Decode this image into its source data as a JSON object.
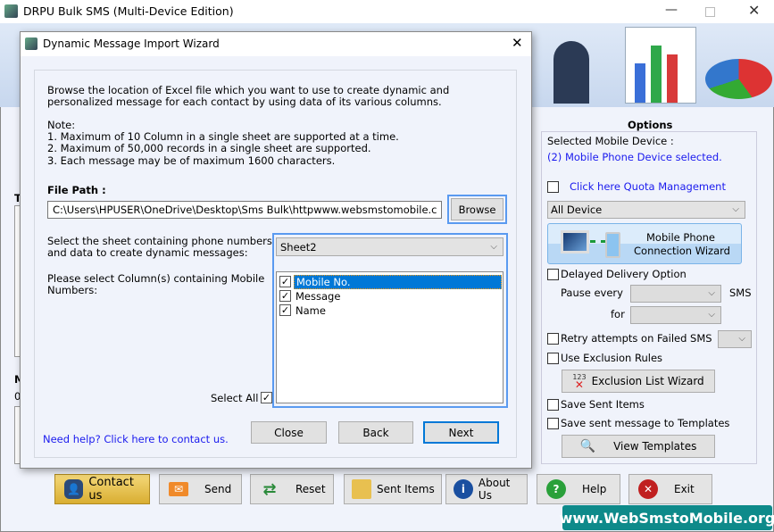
{
  "app": {
    "title": "DRPU Bulk SMS (Multi-Device Edition)",
    "bg_labels": [
      "T",
      "M",
      "0"
    ]
  },
  "options": {
    "title": "Options",
    "selected_device_label": "Selected Mobile Device :",
    "selected_device_value": "(2) Mobile Phone Device selected.",
    "quota_link": "Click here Quota Management",
    "device_select": "All Device",
    "wizard_line1": "Mobile Phone",
    "wizard_line2": "Connection  Wizard",
    "delayed": "Delayed Delivery Option",
    "pause_every": "Pause every",
    "sms": "SMS",
    "for": "for",
    "retry": "Retry attempts on Failed SMS",
    "exclusion": "Use Exclusion Rules",
    "exclusion_wizard": "Exclusion List Wizard",
    "exclusion_icon_text": "123",
    "save_sent": "Save Sent Items",
    "save_templates": "Save sent message to Templates",
    "view_templates": "View Templates"
  },
  "dialog": {
    "title": "Dynamic Message Import Wizard",
    "intro": [
      "Browse the location of Excel file which you want to use to create dynamic and",
      "personalized message for each contact by using data of its various columns."
    ],
    "note_title": "Note:",
    "notes": [
      "1. Maximum of 10 Column in a single sheet are supported at a time.",
      "2. Maximum of 50,000 records in a single sheet are supported.",
      "3. Each message may be of maximum 1600 characters."
    ],
    "file_path_label": "File Path :",
    "file_path_value": "C:\\Users\\HPUSER\\OneDrive\\Desktop\\Sms Bulk\\httpwww.websmstomobile.c",
    "browse": "Browse",
    "sheet_label": [
      "Select the sheet containing phone numbers",
      "and data to create dynamic messages:"
    ],
    "sheet_value": "Sheet2",
    "column_label": [
      "Please select Column(s) containing Mobile",
      "Numbers:"
    ],
    "columns": [
      {
        "label": "Mobile No.",
        "checked": true,
        "selected": true
      },
      {
        "label": "Message",
        "checked": true
      },
      {
        "label": "Name",
        "checked": true
      }
    ],
    "select_all": "Select All",
    "help_link": "Need help? Click here to contact us.",
    "close": "Close",
    "back": "Back",
    "next": "Next"
  },
  "bottom": {
    "contact": "Contact us",
    "send": "Send",
    "reset": "Reset",
    "sent_items": "Sent Items",
    "about": "About Us",
    "help": "Help",
    "exit": "Exit"
  },
  "watermark": "www.WebSmstoMobile.org",
  "colors": {
    "accent": "#0078d7",
    "link": "#1a1aee",
    "watermark": "#0e8a8a"
  }
}
